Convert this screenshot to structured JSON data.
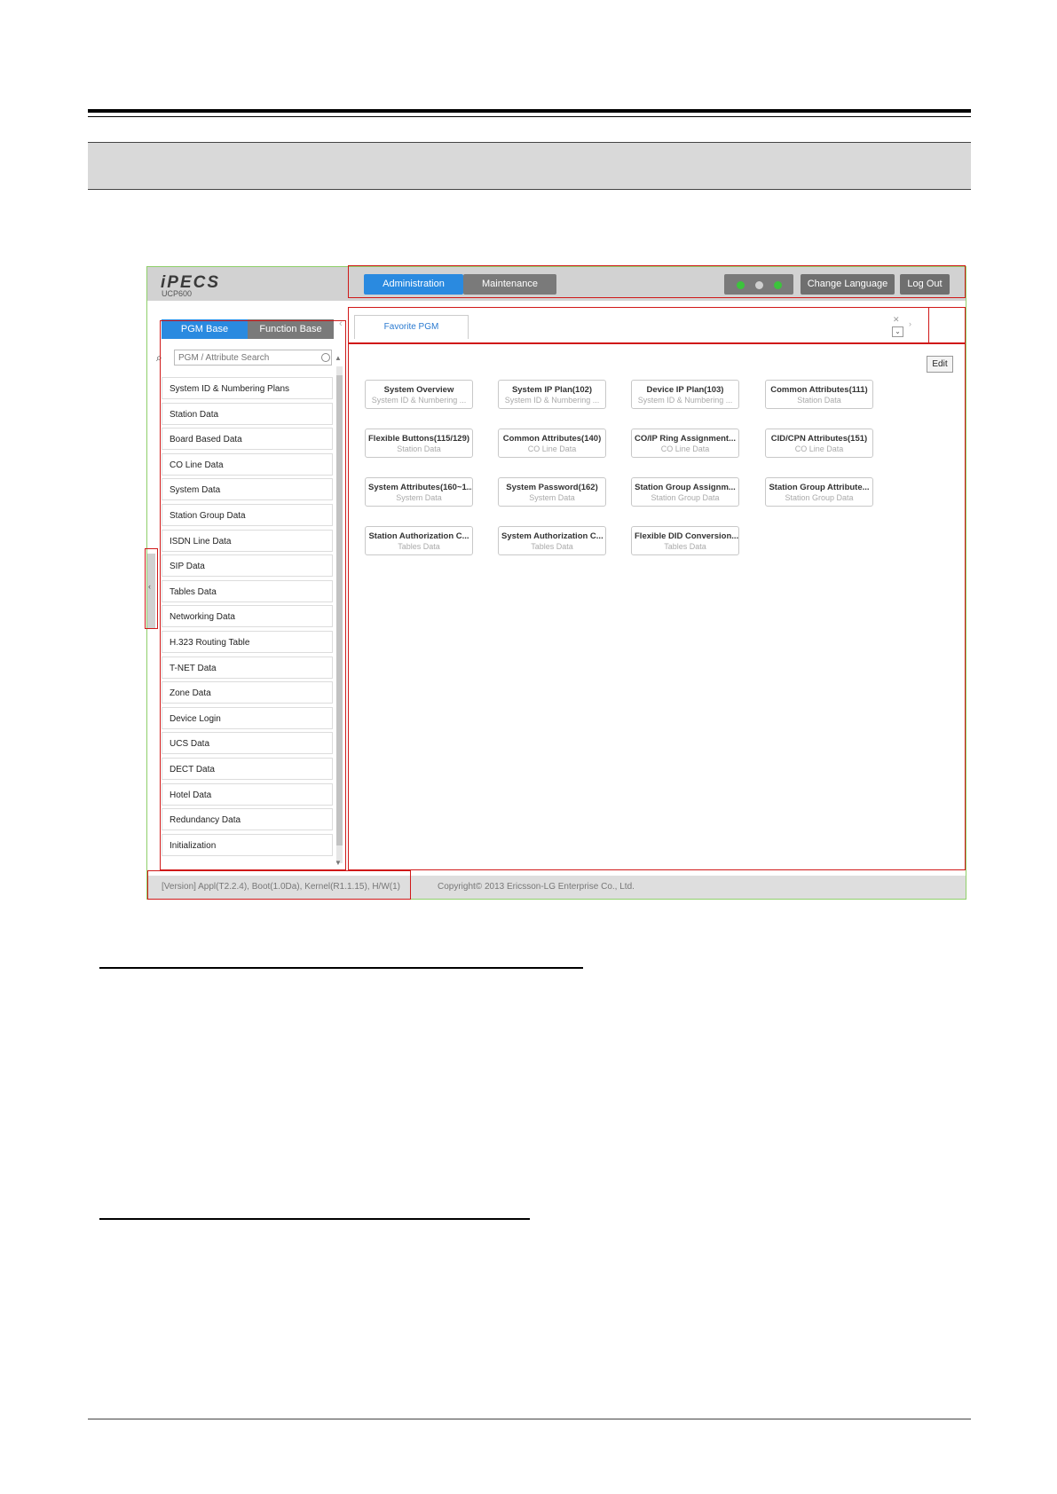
{
  "header": {
    "logo": "iPECS",
    "model": "UCP600",
    "admin_label": "Administration",
    "maint_label": "Maintenance",
    "status_colors": [
      "#3cc43c",
      "#cfcfcf",
      "#3cc43c"
    ],
    "lang_label": "Change Language",
    "logout_label": "Log Out"
  },
  "left_panel": {
    "tab_pgm": "PGM Base",
    "tab_function": "Function Base",
    "search_placeholder": "PGM / Attribute Search",
    "menu": [
      "System ID & Numbering Plans",
      "Station Data",
      "Board Based Data",
      "CO Line Data",
      "System Data",
      "Station Group Data",
      "ISDN Line Data",
      "SIP Data",
      "Tables Data",
      "Networking Data",
      "H.323 Routing Table",
      "T-NET Data",
      "Zone Data",
      "Device Login",
      "UCS Data",
      "DECT Data",
      "Hotel Data",
      "Redundancy Data",
      "Initialization"
    ]
  },
  "main": {
    "favorite_tab": "Favorite PGM",
    "edit_label": "Edit",
    "cards": [
      {
        "title": "System Overview",
        "subtitle": "System ID & Numbering ..."
      },
      {
        "title": "System IP Plan(102)",
        "subtitle": "System ID & Numbering ..."
      },
      {
        "title": "Device IP Plan(103)",
        "subtitle": "System ID & Numbering ..."
      },
      {
        "title": "Common Attributes(111)",
        "subtitle": "Station Data"
      },
      {
        "title": "Flexible Buttons(115/129)",
        "subtitle": "Station Data"
      },
      {
        "title": "Common Attributes(140)",
        "subtitle": "CO Line Data"
      },
      {
        "title": "CO/IP Ring Assignment...",
        "subtitle": "CO Line Data"
      },
      {
        "title": "CID/CPN Attributes(151)",
        "subtitle": "CO Line Data"
      },
      {
        "title": "System Attributes(160~1...",
        "subtitle": "System Data"
      },
      {
        "title": "System Password(162)",
        "subtitle": "System Data"
      },
      {
        "title": "Station Group Assignm...",
        "subtitle": "Station Group Data"
      },
      {
        "title": "Station Group Attribute...",
        "subtitle": "Station Group Data"
      },
      {
        "title": "Station Authorization C...",
        "subtitle": "Tables Data"
      },
      {
        "title": "System Authorization C...",
        "subtitle": "Tables Data"
      },
      {
        "title": "Flexible DID Conversion...",
        "subtitle": "Tables Data"
      }
    ]
  },
  "footer": {
    "version": "[Version] Appl(T2.2.4), Boot(1.0Da), Kernel(R1.1.15), H/W(1)",
    "copyright": "Copyright© 2013 Ericsson-LG Enterprise Co., Ltd."
  },
  "colors": {
    "accent": "#2a8ae0",
    "annotation_red": "#d01818",
    "frame_green": "#8fcf6a"
  }
}
